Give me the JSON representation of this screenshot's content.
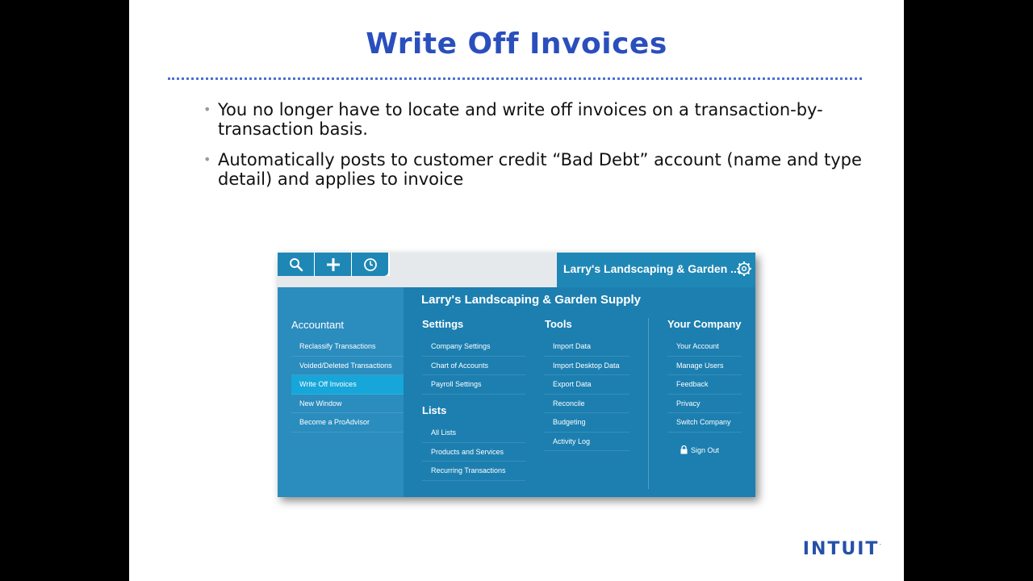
{
  "slide": {
    "title": "Write Off Invoices",
    "bullets": [
      "You no longer have to locate and write off invoices on a transaction-by-transaction basis.",
      "Automatically posts to customer credit “Bad Debt” account (name and type detail) and applies to invoice"
    ],
    "logo": "INTUIT",
    "logo_mark": "."
  },
  "app": {
    "toolbar": {
      "icons": [
        "search-icon",
        "plus-icon",
        "clock-icon"
      ]
    },
    "company_short": "Larry's Landscaping & Garden ...",
    "company_full": "Larry's Landscaping & Garden Supply",
    "accountant": {
      "title": "Accountant",
      "items": [
        "Reclassify Transactions",
        "Voided/Deleted Transactions",
        "Write Off Invoices",
        "New Window",
        "Become a ProAdvisor"
      ]
    },
    "settings": {
      "title": "Settings",
      "items": [
        "Company Settings",
        "Chart of Accounts",
        "Payroll Settings"
      ]
    },
    "lists": {
      "title": "Lists",
      "items": [
        "All Lists",
        "Products and Services",
        "Recurring Transactions"
      ]
    },
    "tools": {
      "title": "Tools",
      "items": [
        "Import Data",
        "Import Desktop Data",
        "Export Data",
        "Reconcile",
        "Budgeting",
        "Activity Log"
      ]
    },
    "your_company": {
      "title": "Your Company",
      "items": [
        "Your Account",
        "Manage Users",
        "Feedback",
        "Privacy",
        "Switch Company"
      ]
    },
    "sign_out": "Sign Out"
  },
  "colors": {
    "title": "#2a4fbd",
    "menu_bg": "#1c7fb0",
    "left_bg": "#2b8cbe",
    "active": "#16a6d9"
  }
}
